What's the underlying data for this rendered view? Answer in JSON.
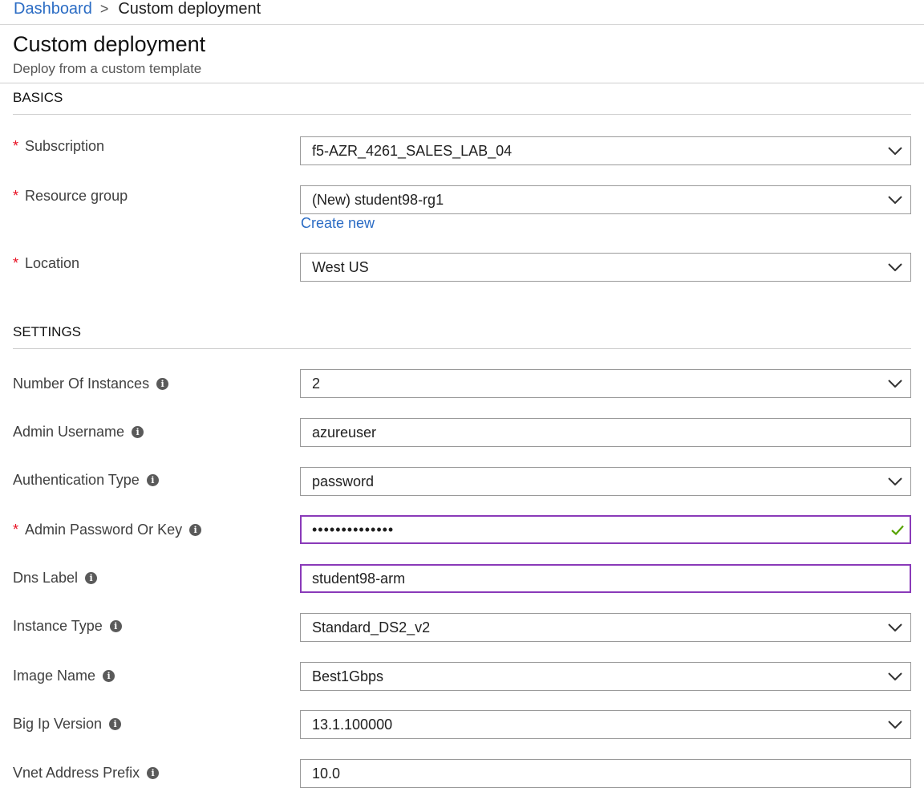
{
  "breadcrumb": {
    "home": "Dashboard",
    "separator": ">",
    "current": "Custom deployment"
  },
  "header": {
    "title": "Custom deployment",
    "subtitle": "Deploy from a custom template"
  },
  "sections": {
    "basics": "BASICS",
    "settings": "SETTINGS"
  },
  "basics": {
    "subscription": {
      "label": "Subscription",
      "value": "f5-AZR_4261_SALES_LAB_04"
    },
    "resource_group": {
      "label": "Resource group",
      "value": "(New) student98-rg1",
      "create_new": "Create new"
    },
    "location": {
      "label": "Location",
      "value": "West US"
    }
  },
  "settings": {
    "instances": {
      "label": "Number Of Instances",
      "value": "2"
    },
    "admin_username": {
      "label": "Admin Username",
      "value": "azureuser"
    },
    "auth_type": {
      "label": "Authentication Type",
      "value": "password"
    },
    "admin_password": {
      "label": "Admin Password Or Key",
      "value": "••••••••••••••"
    },
    "dns_label": {
      "label": "Dns Label",
      "value": "student98-arm"
    },
    "instance_type": {
      "label": "Instance Type",
      "value": "Standard_DS2_v2"
    },
    "image_name": {
      "label": "Image Name",
      "value": "Best1Gbps"
    },
    "bigip_version": {
      "label": "Big Ip Version",
      "value": "13.1.100000"
    },
    "vnet_prefix": {
      "label": "Vnet Address Prefix",
      "value": "10.0"
    }
  },
  "symbols": {
    "required": "*",
    "info": "i"
  },
  "colors": {
    "link": "#2b6cc4",
    "required": "#e81123",
    "focus_border": "#8a3ab9",
    "valid_check": "#57a300"
  },
  "icons": {
    "dropdown": "chevron-down-icon",
    "info": "info-icon",
    "valid": "checkmark-icon"
  }
}
